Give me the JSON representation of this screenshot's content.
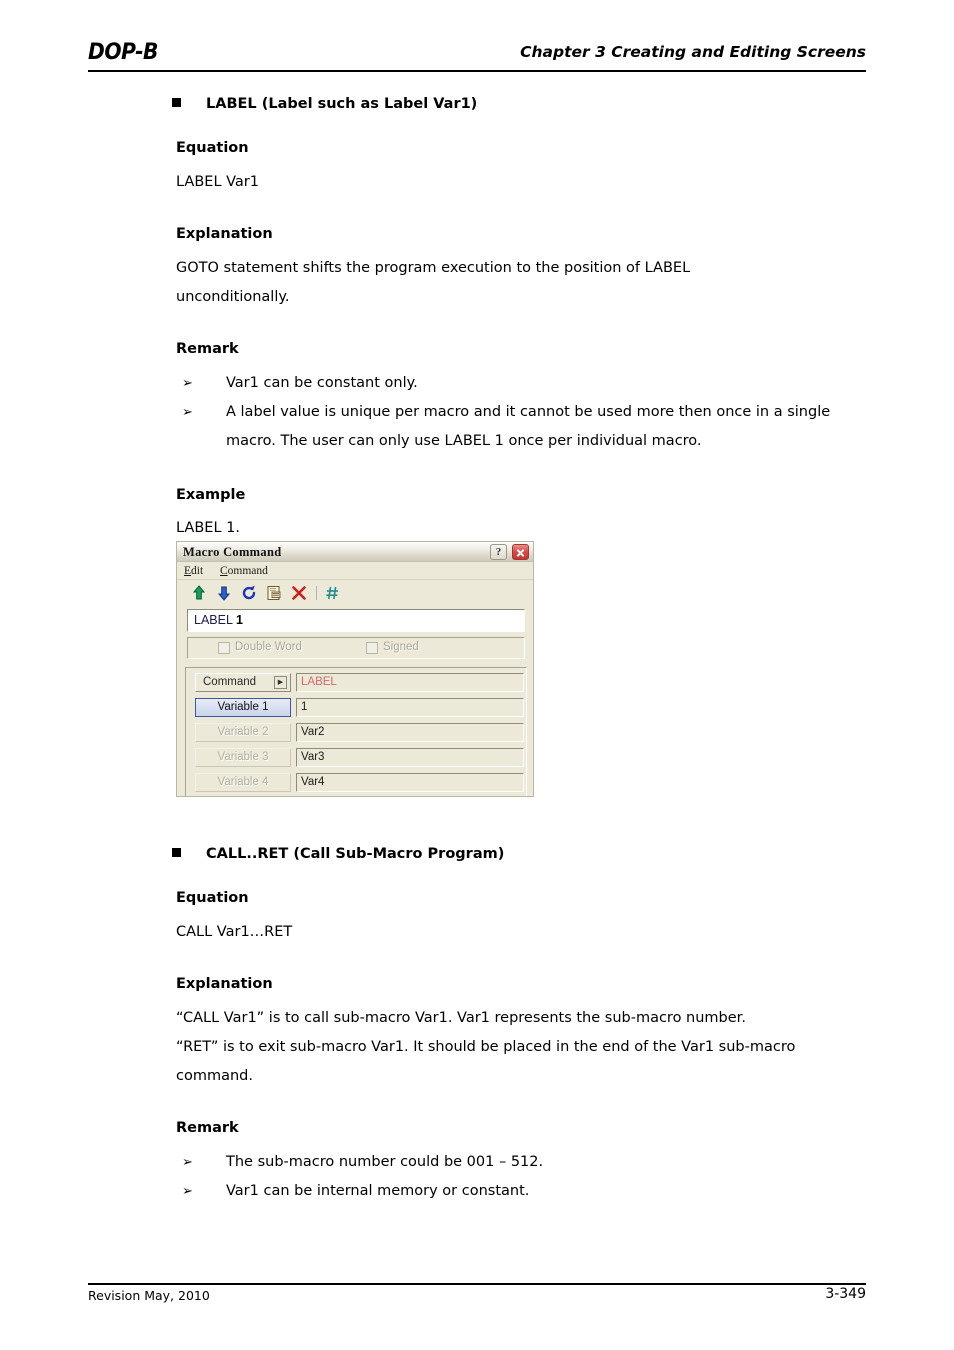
{
  "header": {
    "logo": "DOP-B",
    "chapter_title": "Chapter 3 Creating and Editing Screens"
  },
  "footer": {
    "revision": "Revision May, 2010",
    "page_number": "3-349"
  },
  "sections": [
    {
      "heading": "LABEL (Label such as Label Var1)",
      "equation_label": "Equation",
      "equation_text": "LABEL Var1",
      "explanation_label": "Explanation",
      "explanation_lines": [
        "GOTO statement shifts the program execution to the position of LABEL",
        "unconditionally."
      ],
      "remark_label": "Remark",
      "remarks": [
        "Var1 can be constant only.",
        "A label value is unique per macro and it cannot be used more then once in a single macro. The user can only use LABEL 1 once per individual macro."
      ],
      "example_label": "Example",
      "example_text": "LABEL 1."
    },
    {
      "heading": "CALL..RET (Call Sub-Macro Program)",
      "equation_label": "Equation",
      "equation_text": "CALL Var1…RET",
      "explanation_label": "Explanation",
      "explanation_lines": [
        "“CALL Var1” is to call sub-macro Var1. Var1 represents the sub-macro number.",
        "“RET” is to exit sub-macro Var1. It should be placed in the end of the Var1 sub-macro",
        "command."
      ],
      "remark_label": "Remark",
      "remarks": [
        "The sub-macro number could be 001 – 512.",
        "Var1 can be internal memory or constant."
      ]
    }
  ],
  "remark_bullet_glyph": "➢",
  "dialog": {
    "title": "Macro Command",
    "help_button": "?",
    "menus": [
      {
        "mnemonic": "E",
        "rest": "dit"
      },
      {
        "mnemonic": "C",
        "rest": "ommand"
      }
    ],
    "toolbar_icons": [
      "move-up-icon",
      "move-down-icon",
      "refresh-icon",
      "edit-document-icon",
      "delete-icon",
      "number-sign-icon"
    ],
    "command_line": {
      "prefix": "LABEL ",
      "value": "1"
    },
    "checkboxes": [
      {
        "label": "Double Word",
        "checked": false,
        "disabled": true
      },
      {
        "label": "Signed",
        "checked": false,
        "disabled": true
      }
    ],
    "rows": [
      {
        "button": "Command",
        "value": "LABEL",
        "state": "normal",
        "value_color": "#d06a6a"
      },
      {
        "button": "Variable 1",
        "value": "1",
        "state": "active",
        "value_color": "#1c1c1c"
      },
      {
        "button": "Variable 2",
        "value": "Var2",
        "state": "disabled",
        "value_color": "#1c1c1c"
      },
      {
        "button": "Variable 3",
        "value": "Var3",
        "state": "disabled",
        "value_color": "#1c1c1c"
      },
      {
        "button": "Variable 4",
        "value": "Var4",
        "state": "disabled",
        "value_color": "#1c1c1c"
      }
    ],
    "colors": {
      "face": "#ece9d8",
      "close_button": "#c23731",
      "active_border": "#3b5a9c",
      "command_value": "#d06a6a",
      "command_line_text": "#1c1c4a"
    }
  }
}
